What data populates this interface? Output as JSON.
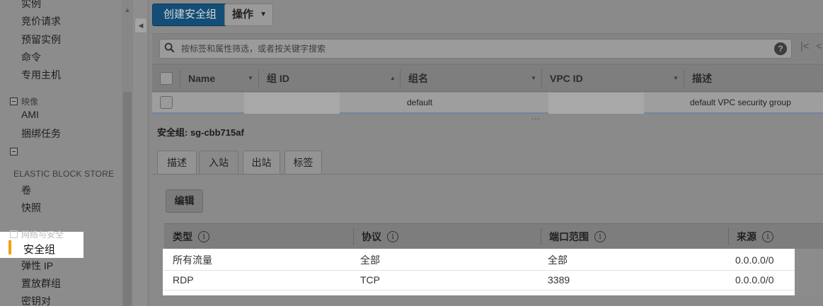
{
  "sidebar": {
    "items_top": [
      "实例",
      "竞价请求",
      "预留实例",
      "命令",
      "专用主机"
    ],
    "section_images": "映像",
    "images_items": [
      "AMI",
      "捆绑任务"
    ],
    "section_ebs": "ELASTIC BLOCK STORE",
    "ebs_items": [
      "卷",
      "快照"
    ],
    "section_network": "网络与安全",
    "active_item": "安全组",
    "network_items": [
      "弹性 IP",
      "置放群组",
      "密钥对"
    ]
  },
  "toolbar": {
    "create_label": "创建安全组",
    "actions_label": "操作"
  },
  "search": {
    "placeholder": "按标签和属性筛选，或者按关键字搜索"
  },
  "grid": {
    "columns": [
      "Name",
      "组 ID",
      "组名",
      "VPC ID",
      "描述"
    ],
    "rows": [
      {
        "name": "",
        "group_id": "",
        "group_name": "default",
        "vpc_id": "",
        "description": "default VPC security group"
      }
    ]
  },
  "detail": {
    "title": "安全组: sg-cbb715af",
    "tabs": [
      "描述",
      "入站",
      "出站",
      "标签"
    ],
    "active_tab": "入站",
    "edit_label": "编辑"
  },
  "rules": {
    "columns": [
      "类型",
      "协议",
      "端口范围",
      "来源"
    ],
    "rows": [
      {
        "type": "所有流量",
        "protocol": "全部",
        "port": "全部",
        "source": "0.0.0.0/0"
      },
      {
        "type": "RDP",
        "protocol": "TCP",
        "port": "3389",
        "source": "0.0.0.0/0"
      }
    ]
  },
  "colors": {
    "primary_button": "#144e76",
    "active_marker": "#f0a010"
  }
}
